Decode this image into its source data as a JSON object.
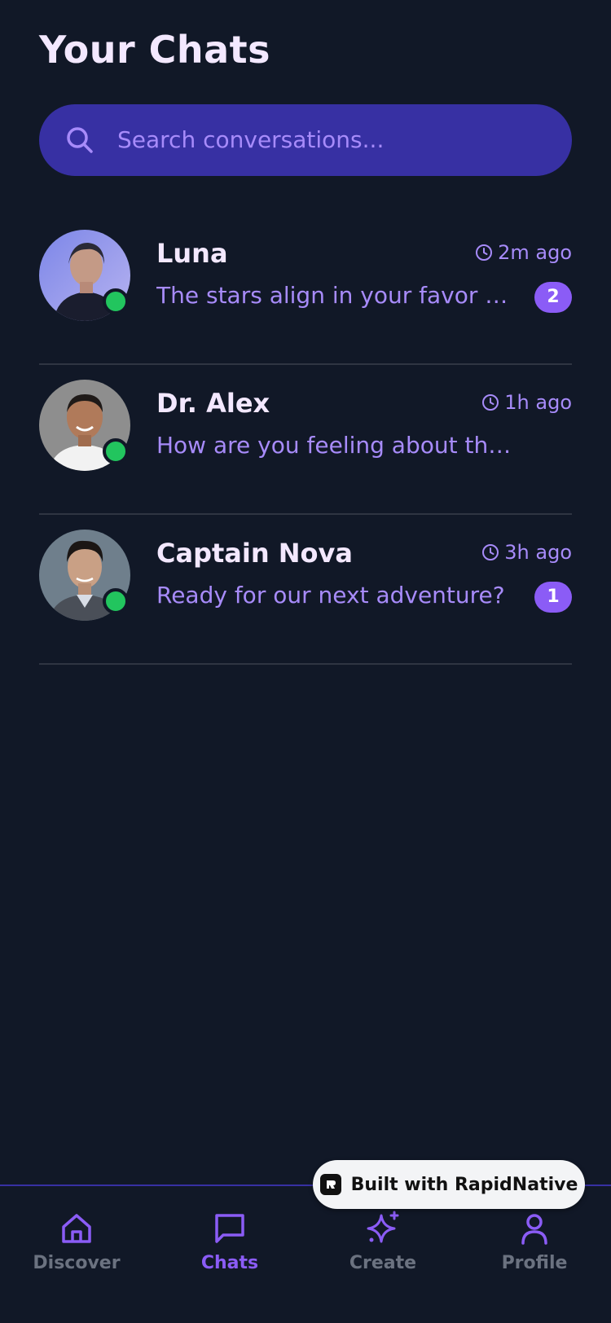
{
  "header": {
    "title": "Your Chats"
  },
  "search": {
    "placeholder": "Search conversations..."
  },
  "chats": [
    {
      "name": "Luna",
      "time": "2m ago",
      "preview": "The stars align in your favor tod...",
      "unread": "2",
      "online": true
    },
    {
      "name": "Dr. Alex",
      "time": "1h ago",
      "preview": "How are you feeling about that?",
      "unread": "",
      "online": true
    },
    {
      "name": "Captain Nova",
      "time": "3h ago",
      "preview": "Ready for our next adventure?",
      "unread": "1",
      "online": true
    }
  ],
  "nav": {
    "items": [
      {
        "label": "Discover",
        "icon": "home-icon",
        "active": false
      },
      {
        "label": "Chats",
        "icon": "chat-bubble-icon",
        "active": true
      },
      {
        "label": "Create",
        "icon": "sparkle-icon",
        "active": false
      },
      {
        "label": "Profile",
        "icon": "user-icon",
        "active": false
      }
    ]
  },
  "built_with": {
    "label": "Built with RapidNative"
  },
  "colors": {
    "background": "#111827",
    "accent": "#8b5cf6",
    "search_bg": "#3730a3",
    "online": "#22c55e",
    "title_text": "#f3e8ff",
    "muted_text": "#a78bfa"
  }
}
